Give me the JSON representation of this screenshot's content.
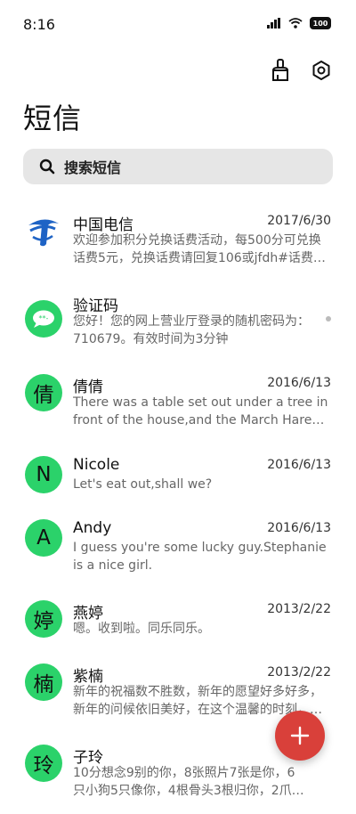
{
  "status_bar": {
    "time": "8:16",
    "battery": "100"
  },
  "header": {
    "title": "短信"
  },
  "search": {
    "placeholder": "搜索短信"
  },
  "conversations": [
    {
      "name": "中国电信",
      "date": "2017/6/30",
      "preview": "欢迎参加积分兑换话费活动，每500分可兑换话费5元，兑换话费请回复106或jfdh#话费…",
      "avatar_type": "telecom-logo-icon"
    },
    {
      "name": "验证码",
      "date": "",
      "preview": "您好！您的网上营业厅登录的随机密码为：710679。有效时间为3分钟",
      "avatar_type": "message-bubble-icon"
    },
    {
      "name": "倩倩",
      "date": "2016/6/13",
      "preview": "There was a table set out under a tree in front of the house,and the March Hare an…",
      "avatar_letter": "倩"
    },
    {
      "name": "Nicole",
      "date": "2016/6/13",
      "preview": "Let's eat out,shall we?",
      "avatar_letter": "N"
    },
    {
      "name": "Andy",
      "date": "2016/6/13",
      "preview": "I guess you're some lucky guy.Stephanie is a nice girl.",
      "avatar_letter": "A"
    },
    {
      "name": "燕婷",
      "date": "2013/2/22",
      "preview": "嗯。收到啦。同乐同乐。",
      "avatar_letter": "婷"
    },
    {
      "name": "紫楠",
      "date": "2013/2/22",
      "preview": "新年的祝福数不胜数，新年的愿望好多好多，新年的问候依旧美好，在这个温馨的时刻，…",
      "avatar_letter": "楠"
    },
    {
      "name": "子玲",
      "date": "",
      "preview": "10分想念9别的你，8张照片7张是你，6只小狗5只像你，4根骨头3根归你，2爪着地1定",
      "avatar_letter": "玲"
    }
  ],
  "colors": {
    "accent_green": "#2bd26a",
    "fab_red": "#d9403a",
    "search_bg": "#e6e6e6"
  }
}
